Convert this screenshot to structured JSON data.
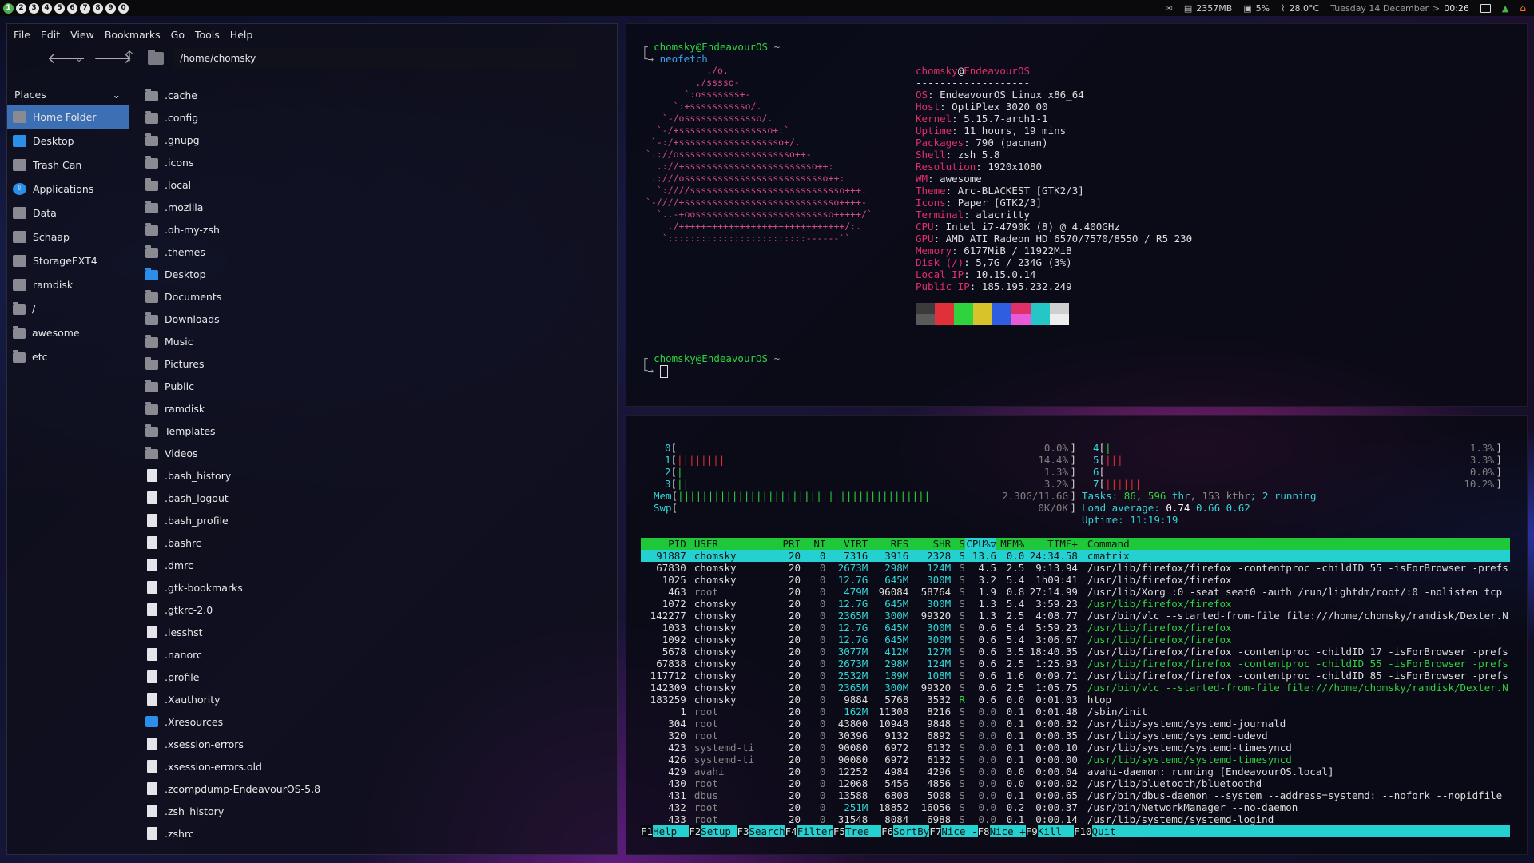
{
  "topbar": {
    "tags": [
      "1",
      "2",
      "3",
      "4",
      "5",
      "6",
      "7",
      "8",
      "9",
      "0"
    ],
    "mem_label": "2357MB",
    "cpu_label": "5%",
    "temp_label": "28.0°C",
    "date_label": "Tuesday 14 December",
    "date_sep": " > ",
    "time_label": "00:26"
  },
  "filemanager": {
    "menu": [
      "File",
      "Edit",
      "View",
      "Bookmarks",
      "Go",
      "Tools",
      "Help"
    ],
    "path": "/home/chomsky",
    "places_title": "Places",
    "places": [
      "Home Folder",
      "Desktop",
      "Trash Can",
      "Applications",
      "Data",
      "Schaap",
      "StorageEXT4",
      "ramdisk",
      "/",
      "awesome",
      "etc"
    ],
    "files": [
      ".cache",
      ".config",
      ".gnupg",
      ".icons",
      ".local",
      ".mozilla",
      ".oh-my-zsh",
      ".themes",
      "Desktop",
      "Documents",
      "Downloads",
      "Music",
      "Pictures",
      "Public",
      "ramdisk",
      "Templates",
      "Videos",
      ".bash_history",
      ".bash_logout",
      ".bash_profile",
      ".bashrc",
      ".dmrc",
      ".gtk-bookmarks",
      ".gtkrc-2.0",
      ".lesshst",
      ".nanorc",
      ".profile",
      ".Xauthority",
      ".Xresources",
      ".xsession-errors",
      ".xsession-errors.old",
      ".zcompdump-EndeavourOS-5.8",
      ".zsh_history",
      ".zshrc"
    ]
  },
  "terminal_top": {
    "prompt_user": "chomsky@EndeavourOS",
    "prompt_dir": " ~",
    "command": "neofetch",
    "logo": [
      "           ./o.",
      "         ./sssso-",
      "       `:osssssss+-",
      "     `:+sssssssssso/.",
      "   `-/ossssssssssssso/.",
      "  `-/+sssssssssssssssso+:`",
      " `-:/+sssssssssssssssssso+/.",
      "`.://osssssssssssssssssssso++-",
      "  .://+ssssssssssssssssssssssso++:",
      " .:///ossssssssssssssssssssssssso++:",
      "  `:////ssssssssssssssssssssssssssso+++.",
      "`-////+ssssssssssssssssssssssssssso++++-",
      "  `..-+oosssssssssssssssssssssssso+++++/`",
      "    ./++++++++++++++++++++++++++++++/:.",
      "   `:::::::::::::::::::::::::------``"
    ],
    "title_user": "chomsky",
    "title_at": "@",
    "title_host": "EndeavourOS",
    "separator": "-------------------",
    "info": [
      {
        "k": "OS",
        "v": "EndeavourOS Linux x86_64"
      },
      {
        "k": "Host",
        "v": "OptiPlex 3020 00"
      },
      {
        "k": "Kernel",
        "v": "5.15.7-arch1-1"
      },
      {
        "k": "Uptime",
        "v": "11 hours, 19 mins"
      },
      {
        "k": "Packages",
        "v": "790 (pacman)"
      },
      {
        "k": "Shell",
        "v": "zsh 5.8"
      },
      {
        "k": "Resolution",
        "v": "1920x1080"
      },
      {
        "k": "WM",
        "v": "awesome"
      },
      {
        "k": "Theme",
        "v": "Arc-BLACKEST [GTK2/3]"
      },
      {
        "k": "Icons",
        "v": "Paper [GTK2/3]"
      },
      {
        "k": "Terminal",
        "v": "alacritty"
      },
      {
        "k": "CPU",
        "v": "Intel i7-4790K (8) @ 4.400GHz"
      },
      {
        "k": "GPU",
        "v": "AMD ATI Radeon HD 6570/7570/8550 / R5 230"
      },
      {
        "k": "Memory",
        "v": "6177MiB / 11922MiB"
      },
      {
        "k": "Disk (/)",
        "v": "5,7G / 234G (3%)"
      },
      {
        "k": "Local IP",
        "v": "10.15.0.14"
      },
      {
        "k": "Public IP",
        "v": "185.195.232.249"
      }
    ],
    "swatches_top": [
      "#3b3b3b",
      "#e0303a",
      "#2ed33e",
      "#d8c42a",
      "#2f5fe0",
      "#e0306a",
      "#25c6c6",
      "#cfcfcf"
    ],
    "swatches_bottom": [
      "#5a5a5a",
      "#e0303a",
      "#2ed33e",
      "#d8c42a",
      "#2f5fe0",
      "#e85ad8",
      "#25c6c6",
      "#ededed"
    ]
  },
  "htop": {
    "cpus": [
      {
        "id": "0",
        "bars": "",
        "pct": "0.0%"
      },
      {
        "id": "1",
        "bars": "||||||||",
        "pct": "14.4%"
      },
      {
        "id": "2",
        "bars": "|",
        "pct": "1.3%"
      },
      {
        "id": "3",
        "bars": "||",
        "pct": "3.2%"
      },
      {
        "id": "4",
        "bars": "|",
        "pct": "1.3%"
      },
      {
        "id": "5",
        "bars": "|||",
        "pct": "3.3%"
      },
      {
        "id": "6",
        "bars": "",
        "pct": "0.0%"
      },
      {
        "id": "7",
        "bars": "||||||",
        "pct": "10.2%"
      }
    ],
    "mem_label": "Mem",
    "mem_bars": "||||||||||||||||||||||||||||||||||||||||||",
    "mem_value": "2.30G/11.6G",
    "swp_label": "Swp",
    "swp_value": "0K/0K",
    "tasks_label": "Tasks: ",
    "tasks": "86",
    "tasks_sep": ", ",
    "thr": "596",
    "thr_label": " thr",
    "kthr": ", 153 kthr",
    "running": "; 2 running",
    "load_label": "Load average: ",
    "load1": "0.74",
    "load5": "0.66",
    "load15": "0.62",
    "uptime_label": "Uptime: ",
    "uptime": "11:19:19",
    "headers": [
      "PID",
      "USER",
      "PRI",
      "NI",
      "VIRT",
      "RES",
      "SHR",
      "S",
      "CPU%▽",
      "MEM%",
      "TIME+",
      "Command"
    ],
    "rows": [
      {
        "pid": "91887",
        "user": "chomsky",
        "pri": "20",
        "ni": "0",
        "virt": "7316",
        "res": "3916",
        "shr": "2328",
        "s": "S",
        "cpu": "13.6",
        "mem": "0.0",
        "time": "24:34.58",
        "cmd": "cmatrix",
        "sel": true
      },
      {
        "pid": "67830",
        "user": "chomsky",
        "pri": "20",
        "ni": "0",
        "virt": "2673M",
        "res": "298M",
        "shr": "124M",
        "s": "S",
        "cpu": "4.5",
        "mem": "2.5",
        "time": "9:13.94",
        "cmd": "/usr/lib/firefox/firefox -contentproc -childID 55 -isForBrowser -prefs"
      },
      {
        "pid": "1025",
        "user": "chomsky",
        "pri": "20",
        "ni": "0",
        "virt": "12.7G",
        "res": "645M",
        "shr": "300M",
        "s": "S",
        "cpu": "3.2",
        "mem": "5.4",
        "time": "1h09:41",
        "cmd": "/usr/lib/firefox/firefox"
      },
      {
        "pid": "463",
        "user": "root",
        "pri": "20",
        "ni": "0",
        "virt": "479M",
        "res": "96084",
        "shr": "58764",
        "s": "S",
        "cpu": "1.9",
        "mem": "0.8",
        "time": "27:14.99",
        "cmd": "/usr/lib/Xorg :0 -seat seat0 -auth /run/lightdm/root/:0 -nolisten tcp"
      },
      {
        "pid": "1072",
        "user": "chomsky",
        "pri": "20",
        "ni": "0",
        "virt": "12.7G",
        "res": "645M",
        "shr": "300M",
        "s": "S",
        "cpu": "1.3",
        "mem": "5.4",
        "time": "3:59.23",
        "cmd": "/usr/lib/firefox/firefox",
        "green": true
      },
      {
        "pid": "142277",
        "user": "chomsky",
        "pri": "20",
        "ni": "0",
        "virt": "2365M",
        "res": "300M",
        "shr": "99320",
        "s": "S",
        "cpu": "1.3",
        "mem": "2.5",
        "time": "4:08.77",
        "cmd": "/usr/bin/vlc --started-from-file file:///home/chomsky/ramdisk/Dexter.N"
      },
      {
        "pid": "1033",
        "user": "chomsky",
        "pri": "20",
        "ni": "0",
        "virt": "12.7G",
        "res": "645M",
        "shr": "300M",
        "s": "S",
        "cpu": "0.6",
        "mem": "5.4",
        "time": "5:59.23",
        "cmd": "/usr/lib/firefox/firefox",
        "green": true
      },
      {
        "pid": "1092",
        "user": "chomsky",
        "pri": "20",
        "ni": "0",
        "virt": "12.7G",
        "res": "645M",
        "shr": "300M",
        "s": "S",
        "cpu": "0.6",
        "mem": "5.4",
        "time": "3:06.67",
        "cmd": "/usr/lib/firefox/firefox",
        "green": true
      },
      {
        "pid": "5678",
        "user": "chomsky",
        "pri": "20",
        "ni": "0",
        "virt": "3077M",
        "res": "412M",
        "shr": "127M",
        "s": "S",
        "cpu": "0.6",
        "mem": "3.5",
        "time": "18:40.35",
        "cmd": "/usr/lib/firefox/firefox -contentproc -childID 17 -isForBrowser -prefs"
      },
      {
        "pid": "67838",
        "user": "chomsky",
        "pri": "20",
        "ni": "0",
        "virt": "2673M",
        "res": "298M",
        "shr": "124M",
        "s": "S",
        "cpu": "0.6",
        "mem": "2.5",
        "time": "1:25.93",
        "cmd": "/usr/lib/firefox/firefox -contentproc -childID 55 -isForBrowser -prefs",
        "green": true
      },
      {
        "pid": "117712",
        "user": "chomsky",
        "pri": "20",
        "ni": "0",
        "virt": "2532M",
        "res": "189M",
        "shr": "108M",
        "s": "S",
        "cpu": "0.6",
        "mem": "1.6",
        "time": "0:09.71",
        "cmd": "/usr/lib/firefox/firefox -contentproc -childID 85 -isForBrowser -prefs"
      },
      {
        "pid": "142309",
        "user": "chomsky",
        "pri": "20",
        "ni": "0",
        "virt": "2365M",
        "res": "300M",
        "shr": "99320",
        "s": "S",
        "cpu": "0.6",
        "mem": "2.5",
        "time": "1:05.75",
        "cmd": "/usr/bin/vlc --started-from-file file:///home/chomsky/ramdisk/Dexter.N",
        "green": true
      },
      {
        "pid": "183259",
        "user": "chomsky",
        "pri": "20",
        "ni": "0",
        "virt": "9884",
        "res": "5768",
        "shr": "3532",
        "s": "R",
        "cpu": "0.6",
        "mem": "0.0",
        "time": "0:01.03",
        "cmd": "htop"
      },
      {
        "pid": "1",
        "user": "root",
        "pri": "20",
        "ni": "0",
        "virt": "162M",
        "res": "11308",
        "shr": "8216",
        "s": "S",
        "cpu": "0.0",
        "mem": "0.1",
        "time": "0:01.48",
        "cmd": "/sbin/init"
      },
      {
        "pid": "304",
        "user": "root",
        "pri": "20",
        "ni": "0",
        "virt": "43800",
        "res": "10948",
        "shr": "9848",
        "s": "S",
        "cpu": "0.0",
        "mem": "0.1",
        "time": "0:00.32",
        "cmd": "/usr/lib/systemd/systemd-journald"
      },
      {
        "pid": "320",
        "user": "root",
        "pri": "20",
        "ni": "0",
        "virt": "30396",
        "res": "9132",
        "shr": "6892",
        "s": "S",
        "cpu": "0.0",
        "mem": "0.1",
        "time": "0:00.35",
        "cmd": "/usr/lib/systemd/systemd-udevd"
      },
      {
        "pid": "423",
        "user": "systemd-ti",
        "pri": "20",
        "ni": "0",
        "virt": "90080",
        "res": "6972",
        "shr": "6132",
        "s": "S",
        "cpu": "0.0",
        "mem": "0.1",
        "time": "0:00.10",
        "cmd": "/usr/lib/systemd/systemd-timesyncd"
      },
      {
        "pid": "426",
        "user": "systemd-ti",
        "pri": "20",
        "ni": "0",
        "virt": "90080",
        "res": "6972",
        "shr": "6132",
        "s": "S",
        "cpu": "0.0",
        "mem": "0.1",
        "time": "0:00.00",
        "cmd": "/usr/lib/systemd/systemd-timesyncd",
        "green": true
      },
      {
        "pid": "429",
        "user": "avahi",
        "pri": "20",
        "ni": "0",
        "virt": "12252",
        "res": "4984",
        "shr": "4296",
        "s": "S",
        "cpu": "0.0",
        "mem": "0.0",
        "time": "0:00.04",
        "cmd": "avahi-daemon: running [EndeavourOS.local]"
      },
      {
        "pid": "430",
        "user": "root",
        "pri": "20",
        "ni": "0",
        "virt": "12068",
        "res": "5456",
        "shr": "4856",
        "s": "S",
        "cpu": "0.0",
        "mem": "0.0",
        "time": "0:00.02",
        "cmd": "/usr/lib/bluetooth/bluetoothd"
      },
      {
        "pid": "431",
        "user": "dbus",
        "pri": "20",
        "ni": "0",
        "virt": "13588",
        "res": "6808",
        "shr": "5008",
        "s": "S",
        "cpu": "0.0",
        "mem": "0.1",
        "time": "0:00.65",
        "cmd": "/usr/bin/dbus-daemon --system --address=systemd: --nofork --nopidfile"
      },
      {
        "pid": "432",
        "user": "root",
        "pri": "20",
        "ni": "0",
        "virt": "251M",
        "res": "18852",
        "shr": "16056",
        "s": "S",
        "cpu": "0.0",
        "mem": "0.2",
        "time": "0:00.37",
        "cmd": "/usr/bin/NetworkManager --no-daemon"
      },
      {
        "pid": "433",
        "user": "root",
        "pri": "20",
        "ni": "0",
        "virt": "31548",
        "res": "8084",
        "shr": "6988",
        "s": "S",
        "cpu": "0.0",
        "mem": "0.1",
        "time": "0:00.14",
        "cmd": "/usr/lib/systemd/systemd-logind"
      }
    ],
    "fkeys": [
      {
        "k": "F1",
        "l": "Help  "
      },
      {
        "k": "F2",
        "l": "Setup "
      },
      {
        "k": "F3",
        "l": "Search"
      },
      {
        "k": "F4",
        "l": "Filter"
      },
      {
        "k": "F5",
        "l": "Tree  "
      },
      {
        "k": "F6",
        "l": "SortBy"
      },
      {
        "k": "F7",
        "l": "Nice -"
      },
      {
        "k": "F8",
        "l": "Nice +"
      },
      {
        "k": "F9",
        "l": "Kill  "
      },
      {
        "k": "F10",
        "l": "Quit"
      }
    ]
  }
}
